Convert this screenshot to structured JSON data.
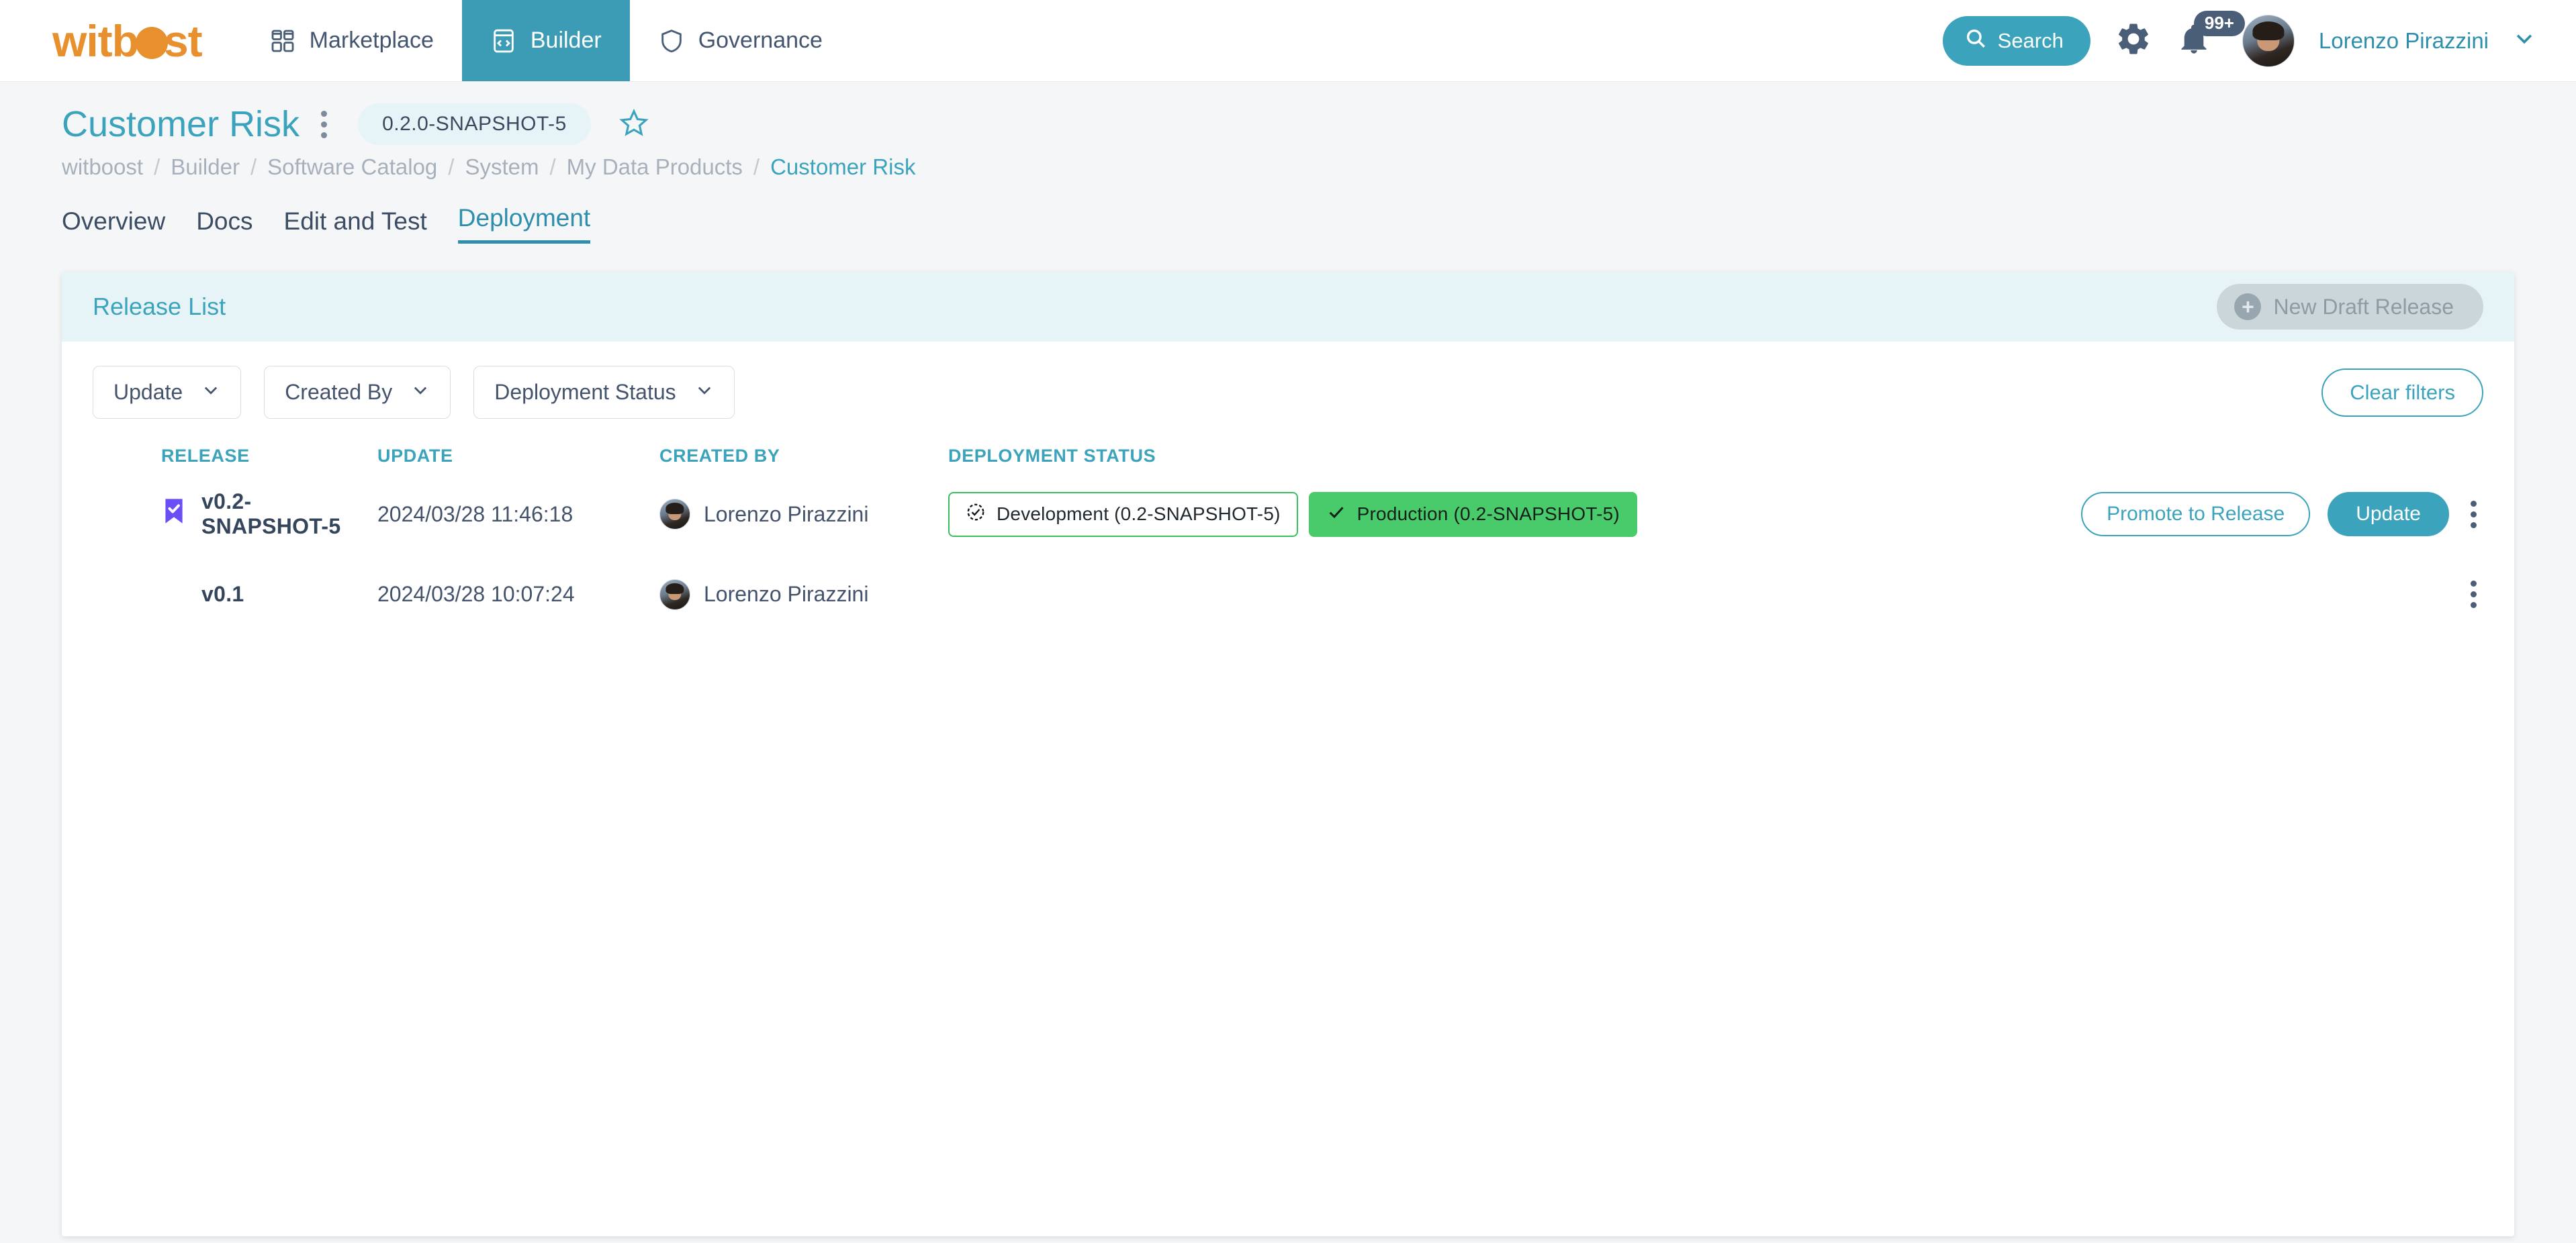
{
  "topnav": {
    "logo_text_1": "witb",
    "logo_text_2": "st",
    "items": [
      {
        "label": "Marketplace",
        "icon": "grid-icon",
        "active": false
      },
      {
        "label": "Builder",
        "icon": "code-icon",
        "active": true
      },
      {
        "label": "Governance",
        "icon": "shield-icon",
        "active": false
      }
    ],
    "search_label": "Search",
    "notification_badge": "99+",
    "username": "Lorenzo Pirazzini",
    "accent_color": "#3CA3BC",
    "brand_color": "#E8902E"
  },
  "page": {
    "title": "Customer Risk",
    "version_chip": "0.2.0-SNAPSHOT-5",
    "breadcrumb": [
      "witboost",
      "Builder",
      "Software Catalog",
      "System",
      "My Data Products",
      "Customer Risk"
    ],
    "tabs": [
      {
        "label": "Overview",
        "active": false
      },
      {
        "label": "Docs",
        "active": false
      },
      {
        "label": "Edit and Test",
        "active": false
      },
      {
        "label": "Deployment",
        "active": true
      }
    ]
  },
  "release_list": {
    "card_title": "Release List",
    "new_draft_label": "New Draft Release",
    "filters": [
      {
        "label": "Update"
      },
      {
        "label": "Created By"
      },
      {
        "label": "Deployment Status"
      }
    ],
    "clear_filters_label": "Clear filters",
    "columns": [
      "RELEASE",
      "UPDATE",
      "CREATED BY",
      "DEPLOYMENT STATUS"
    ],
    "rows": [
      {
        "release": "v0.2-SNAPSHOT-5",
        "bookmarked": true,
        "update": "2024/03/28 11:46:18",
        "created_by": "Lorenzo Pirazzini",
        "statuses": [
          {
            "label": "Development (0.2-SNAPSHOT-5)",
            "style": "outline"
          },
          {
            "label": "Production (0.2-SNAPSHOT-5)",
            "style": "solid"
          }
        ],
        "actions": [
          {
            "label": "Promote to Release",
            "style": "outline"
          },
          {
            "label": "Update",
            "style": "solid"
          }
        ]
      },
      {
        "release": "v0.1",
        "bookmarked": false,
        "update": "2024/03/28 10:07:24",
        "created_by": "Lorenzo Pirazzini",
        "statuses": [],
        "actions": []
      }
    ]
  }
}
